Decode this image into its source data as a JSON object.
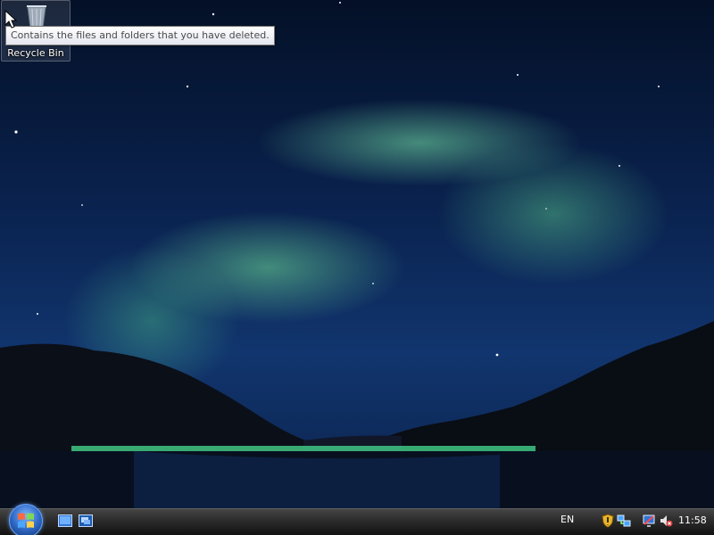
{
  "desktop": {
    "icons": [
      {
        "label": "Recycle Bin",
        "icon": "recycle-bin-icon",
        "selected": true
      }
    ],
    "tooltip": "Contains the files and folders that you have deleted."
  },
  "taskbar": {
    "start_icon": "windows-logo-icon",
    "quick_launch": [
      {
        "icon": "show-desktop-icon"
      },
      {
        "icon": "switch-windows-icon"
      }
    ],
    "language": "EN",
    "tray_icons": [
      {
        "icon": "security-shield-icon"
      },
      {
        "icon": "network-icon"
      },
      {
        "icon": "volume-muted-icon"
      }
    ],
    "clock": "11:58"
  },
  "colors": {
    "taskbar_top": "#454545",
    "taskbar_bottom": "#121212",
    "aurora_green": "#78e6aa",
    "sky_blue": "#11356e"
  }
}
